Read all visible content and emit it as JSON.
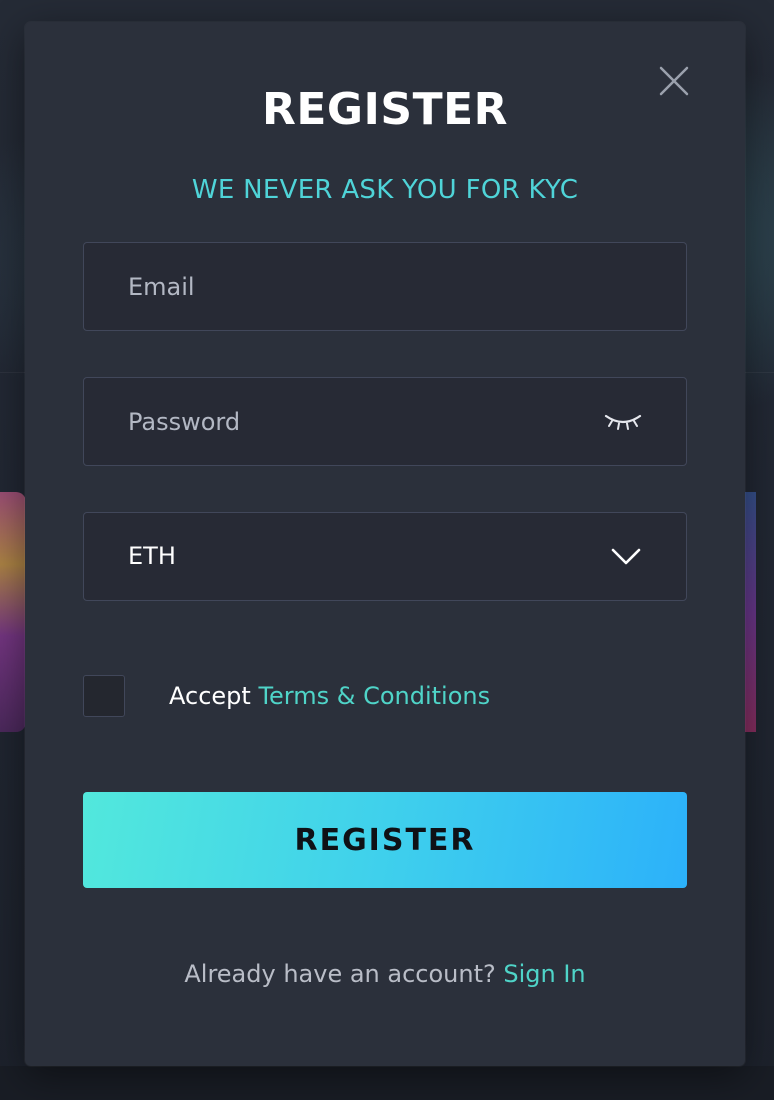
{
  "modal": {
    "title": "REGISTER",
    "subtitle": "WE NEVER ASK YOU FOR KYC",
    "close_icon": "close-icon"
  },
  "form": {
    "email": {
      "placeholder": "Email",
      "value": ""
    },
    "password": {
      "placeholder": "Password",
      "value": "",
      "toggle_icon": "eye-closed-icon"
    },
    "currency": {
      "selected": "ETH",
      "icon": "chevron-down-icon"
    },
    "terms": {
      "checked": false,
      "prefix": "Accept ",
      "link_label": "Terms & Conditions"
    },
    "submit_label": "REGISTER"
  },
  "footer": {
    "prompt": "Already have an account? ",
    "link_label": "Sign In"
  },
  "colors": {
    "accent": "#4fd4c8",
    "modal_bg": "#2b303b",
    "field_bg": "#272a35",
    "button_gradient_start": "#52e8dc",
    "button_gradient_end": "#2cb1fa"
  }
}
